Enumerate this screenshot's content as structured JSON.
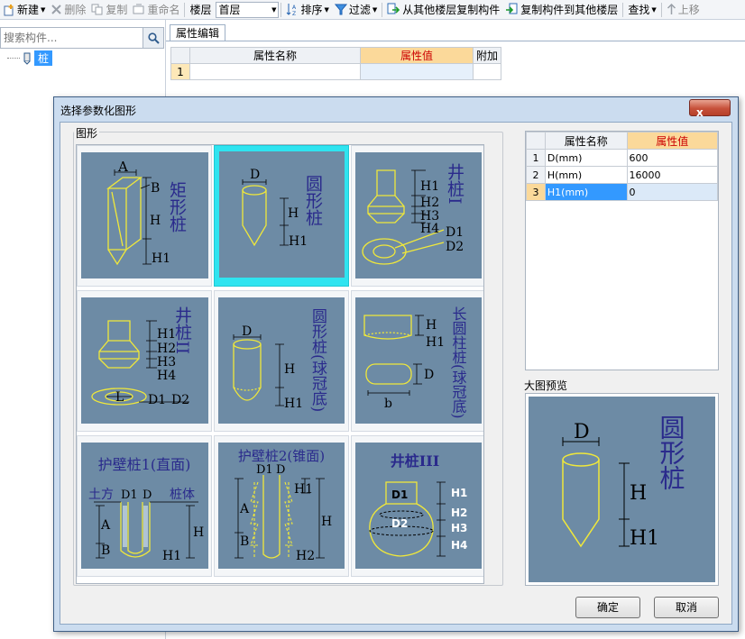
{
  "toolbar": {
    "new_label": "新建",
    "delete_label": "删除",
    "copy_label": "复制",
    "rename_label": "重命名",
    "floor_label": "楼层",
    "floor_value": "首层",
    "sort_label": "排序",
    "filter_label": "过滤",
    "copy_from_label": "从其他楼层复制构件",
    "copy_to_label": "复制构件到其他楼层",
    "find_label": "查找",
    "move_up_label": "上移"
  },
  "left_panel": {
    "search_placeholder": "搜索构件...",
    "tree_item": "桩"
  },
  "property_editor": {
    "tab_label": "属性编辑",
    "col_name": "属性名称",
    "col_value": "属性值",
    "col_extra": "附加",
    "row_number": "1"
  },
  "dialog": {
    "title": "选择参数化图形",
    "close_label": "x",
    "group_label": "图形",
    "preview_label": "大图预览",
    "ok_label": "确定",
    "cancel_label": "取消",
    "param_table": {
      "col_name": "属性名称",
      "col_value": "属性值",
      "rows": [
        {
          "num": "1",
          "name": "D(mm)",
          "value": "600"
        },
        {
          "num": "2",
          "name": "H(mm)",
          "value": "16000"
        },
        {
          "num": "3",
          "name": "H1(mm)",
          "value": "0"
        }
      ]
    },
    "shapes": [
      {
        "title": "矩形桩",
        "labels": [
          "A",
          "B",
          "H",
          "H1"
        ]
      },
      {
        "title": "圆形桩",
        "labels": [
          "D",
          "H",
          "H1"
        ],
        "selected": true
      },
      {
        "title": "井桩I",
        "labels": [
          "H1",
          "H2",
          "H3",
          "H4",
          "D1",
          "D2"
        ]
      },
      {
        "title": "井桩II",
        "labels": [
          "H1",
          "H2",
          "H3",
          "H4",
          "L",
          "D1",
          "D2"
        ]
      },
      {
        "title": "圆形桩(球冠底)",
        "labels": [
          "D",
          "H",
          "H1"
        ]
      },
      {
        "title": "长圆柱桩(球冠底)",
        "labels": [
          "H",
          "H1",
          "D",
          "b"
        ]
      },
      {
        "title": "护壁桩1(直面)",
        "labels": [
          "土方",
          "桩体",
          "D1",
          "D",
          "A",
          "B",
          "H",
          "H1"
        ]
      },
      {
        "title": "护壁桩2(锥面)",
        "labels": [
          "D1",
          "D",
          "H1",
          "A",
          "B",
          "H",
          "H2"
        ]
      },
      {
        "title": "井桩III",
        "labels": [
          "D1",
          "D2",
          "H1",
          "H2",
          "H3",
          "H4"
        ]
      }
    ],
    "preview": {
      "title": "圆形桩",
      "labels": [
        "D",
        "H",
        "H1"
      ]
    }
  },
  "colors": {
    "tile_bg": "#6d8ba5",
    "drawing_line": "#f0e83a",
    "drawing_text": "#2a2a8c",
    "selection": "#2fe4f0"
  }
}
